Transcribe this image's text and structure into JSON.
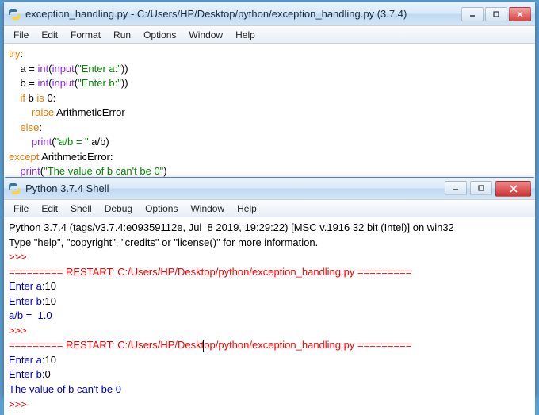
{
  "editor": {
    "title": "exception_handling.py - C:/Users/HP/Desktop/python/exception_handling.py (3.7.4)",
    "menus": {
      "file": "File",
      "edit": "Edit",
      "format": "Format",
      "run": "Run",
      "options": "Options",
      "window": "Window",
      "help": "Help"
    },
    "code": {
      "l1a": "try",
      "l1b": ":",
      "l2a": "    a = ",
      "l2b": "int",
      "l2c": "(",
      "l2d": "input",
      "l2e": "(",
      "l2f": "\"Enter a:\"",
      "l2g": "))",
      "l3a": "    b = ",
      "l3b": "int",
      "l3c": "(",
      "l3d": "input",
      "l3e": "(",
      "l3f": "\"Enter b:\"",
      "l3g": "))",
      "l4a": "    ",
      "l4b": "if",
      "l4c": " b ",
      "l4d": "is",
      "l4e": " ",
      "l4f": "0",
      "l4g": ":",
      "l5a": "        ",
      "l5b": "raise",
      "l5c": " ArithmeticError",
      "l6a": "    ",
      "l6b": "else",
      "l6c": ":",
      "l7a": "        ",
      "l7b": "print",
      "l7c": "(",
      "l7d": "\"a/b = \"",
      "l7e": ",a/b)",
      "l8a": "except",
      "l8b": " ArithmeticError:",
      "l9a": "    ",
      "l9b": "print",
      "l9c": "(",
      "l9d": "\"The value of b can't be 0\"",
      "l9e": ")"
    }
  },
  "shell": {
    "title": "Python 3.7.4 Shell",
    "menus": {
      "file": "File",
      "edit": "Edit",
      "shell": "Shell",
      "debug": "Debug",
      "options": "Options",
      "window": "Window",
      "help": "Help"
    },
    "out": {
      "l1": "Python 3.7.4 (tags/v3.7.4:e09359112e, Jul  8 2019, 19:29:22) [MSC v.1916 32 bit (Intel)] on win32",
      "l2": "Type \"help\", \"copyright\", \"credits\" or \"license()\" for more information.",
      "p": ">>> ",
      "r1": "========= RESTART: C:/Users/HP/Deskt",
      "r1b": "op/python/exception_handling.py =========",
      "ea": "Enter a:",
      "eb": "Enter b:",
      "a1": "10",
      "b1": "10",
      "res1": "a/b =  1.0",
      "a2": "10",
      "b2": "0",
      "res2": "The value of b can't be 0",
      "r2": "========= RESTART: C:/Users/HP/Desktop/python/exception_handling.py ========="
    }
  }
}
